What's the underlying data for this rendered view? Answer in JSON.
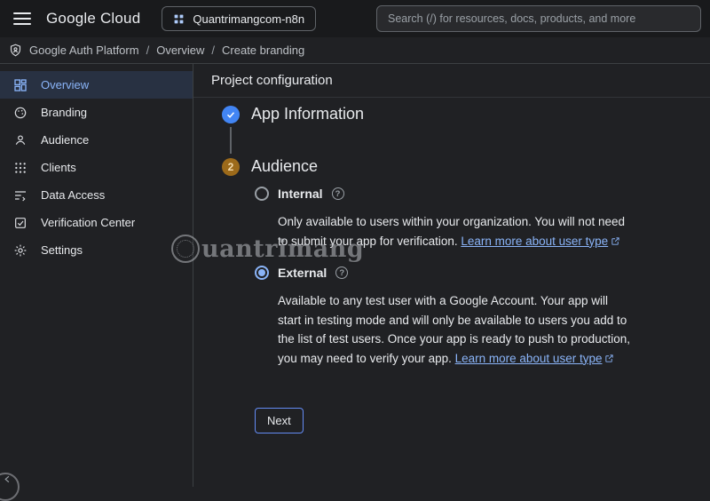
{
  "topbar": {
    "logo": "Google Cloud",
    "project_selector": "Quantrimangcom-n8n",
    "search_placeholder": "Search (/) for resources, docs, products, and more"
  },
  "breadcrumb": {
    "separator": "/",
    "items": [
      "Google Auth Platform",
      "Overview",
      "Create branding"
    ]
  },
  "sidebar": {
    "items": [
      {
        "label": "Overview",
        "icon": "overview-icon",
        "selected": true
      },
      {
        "label": "Branding",
        "icon": "branding-icon",
        "selected": false
      },
      {
        "label": "Audience",
        "icon": "audience-icon",
        "selected": false
      },
      {
        "label": "Clients",
        "icon": "clients-icon",
        "selected": false
      },
      {
        "label": "Data Access",
        "icon": "data-access-icon",
        "selected": false
      },
      {
        "label": "Verification Center",
        "icon": "verification-center-icon",
        "selected": false
      },
      {
        "label": "Settings",
        "icon": "settings-icon",
        "selected": false
      }
    ]
  },
  "main": {
    "title": "Project configuration",
    "steps": [
      {
        "label": "App Information",
        "state": "completed"
      },
      {
        "label": "Audience",
        "number": "2",
        "state": "active"
      }
    ],
    "audience": {
      "options": [
        {
          "label": "Internal",
          "selected": false,
          "description": "Only available to users within your organization. You will not need to submit your app for verification. ",
          "link_text": "Learn more about user type"
        },
        {
          "label": "External",
          "selected": true,
          "description": "Available to any test user with a Google Account. Your app will start in testing mode and will only be available to users you add to the list of test users. Once your app is ready to push to production, you may need to verify your app. ",
          "link_text": "Learn more about user type"
        }
      ],
      "next_button": "Next"
    }
  },
  "icons": {
    "help": "?"
  },
  "watermark": {
    "text": "uantrimang"
  },
  "colors": {
    "background": "#202124",
    "accent": "#8ab4f8",
    "link": "#8ab4f8",
    "step_completed": "#4285f4",
    "step_active": "#9c6a1a",
    "selected_nav_bg": "#283142",
    "text_primary": "#e8eaed",
    "text_secondary": "#bdc1c6"
  }
}
